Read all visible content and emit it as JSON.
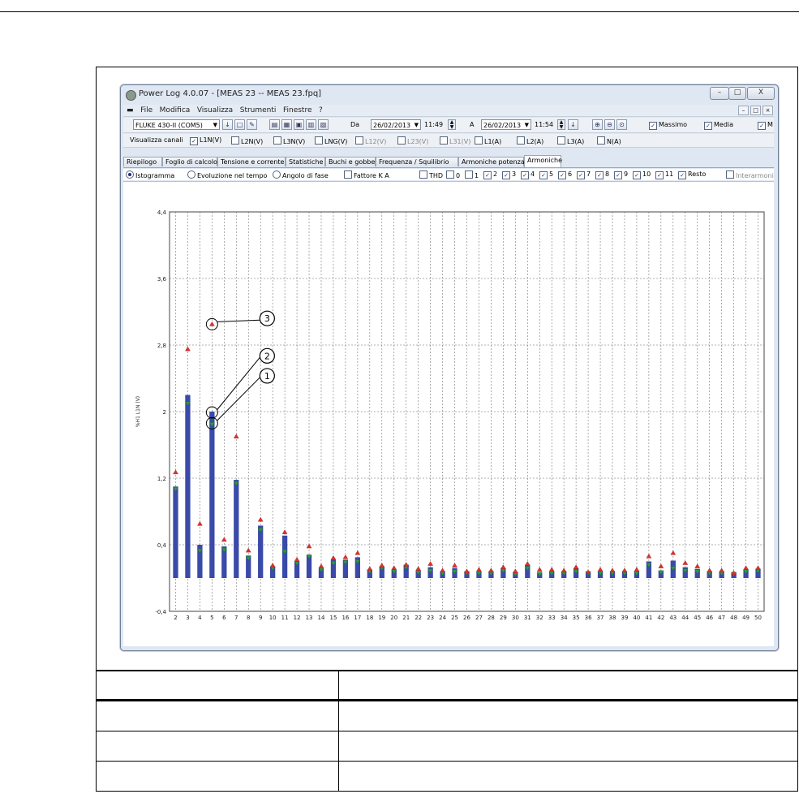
{
  "window": {
    "title": "Power Log 4.0.07 - [MEAS 23 -- MEAS 23.fpq]",
    "controls": {
      "minimize": "–",
      "maximize": "□",
      "close": "X"
    }
  },
  "menu": [
    "File",
    "Modifica",
    "Visualizza",
    "Strumenti",
    "Finestre",
    "?"
  ],
  "mdi_controls": [
    "–",
    "□",
    "×"
  ],
  "toolbar": {
    "device": "FLUKE 430-II (COM5)",
    "from_label": "Da",
    "from_date": "26/02/2013",
    "from_time": "11:49",
    "to_label": "A",
    "to_date": "26/02/2013",
    "to_time": "11:54",
    "checks": [
      {
        "label": "Massimo",
        "checked": true
      },
      {
        "label": "Media",
        "checked": true
      },
      {
        "label": "M",
        "checked": true
      }
    ]
  },
  "channels": {
    "label": "Visualizza canali",
    "items": [
      {
        "label": "L1N(V)",
        "checked": true,
        "enabled": true
      },
      {
        "label": "L2N(V)",
        "checked": false,
        "enabled": true
      },
      {
        "label": "L3N(V)",
        "checked": false,
        "enabled": true
      },
      {
        "label": "LNG(V)",
        "checked": false,
        "enabled": true
      },
      {
        "label": "L12(V)",
        "checked": false,
        "enabled": false
      },
      {
        "label": "L23(V)",
        "checked": false,
        "enabled": false
      },
      {
        "label": "L31(V)",
        "checked": false,
        "enabled": false
      },
      {
        "label": "L1(A)",
        "checked": false,
        "enabled": true
      },
      {
        "label": "L2(A)",
        "checked": false,
        "enabled": true
      },
      {
        "label": "L3(A)",
        "checked": false,
        "enabled": true
      },
      {
        "label": "N(A)",
        "checked": false,
        "enabled": true
      }
    ]
  },
  "tabs": [
    "Riepilogo",
    "Foglio di calcolo",
    "Tensione e corrente",
    "Statistiche",
    "Buchi e gobbe",
    "Frequenza / Squilibrio",
    "Armoniche potenza",
    "Armoniche"
  ],
  "active_tab": "Armoniche",
  "options": {
    "radios": [
      {
        "label": "Istogramma",
        "selected": true
      },
      {
        "label": "Evoluzione nel tempo",
        "selected": false
      },
      {
        "label": "Angolo di fase",
        "selected": false
      }
    ],
    "factor_k": "Fattore K A",
    "harmonics": [
      {
        "label": "THD",
        "checked": false
      },
      {
        "label": "0",
        "checked": false
      },
      {
        "label": "1",
        "checked": false
      },
      {
        "label": "2",
        "checked": true
      },
      {
        "label": "3",
        "checked": true
      },
      {
        "label": "4",
        "checked": true
      },
      {
        "label": "5",
        "checked": true
      },
      {
        "label": "6",
        "checked": true
      },
      {
        "label": "7",
        "checked": true
      },
      {
        "label": "8",
        "checked": true
      },
      {
        "label": "9",
        "checked": true
      },
      {
        "label": "10",
        "checked": true
      },
      {
        "label": "11",
        "checked": true
      },
      {
        "label": "Resto",
        "checked": true
      }
    ],
    "interharmonics": "Interarmoni"
  },
  "callouts": [
    "1",
    "2",
    "3"
  ],
  "colors": {
    "bar": "#3a4aa8",
    "max": "#e03030",
    "avg": "#2d9a3c"
  },
  "chart_data": {
    "type": "bar",
    "ylabel": "%H1 L1N (V)",
    "ylim": [
      -0.4,
      4.4
    ],
    "yticks": [
      "4,4",
      "3,6",
      "2,8",
      "2",
      "1,2",
      "0,4",
      "-0,4"
    ],
    "categories": [
      "2",
      "3",
      "4",
      "5",
      "6",
      "7",
      "8",
      "9",
      "10",
      "11",
      "12",
      "13",
      "14",
      "15",
      "16",
      "17",
      "18",
      "19",
      "20",
      "21",
      "22",
      "23",
      "24",
      "25",
      "26",
      "27",
      "28",
      "29",
      "30",
      "31",
      "32",
      "33",
      "34",
      "35",
      "36",
      "37",
      "38",
      "39",
      "40",
      "41",
      "42",
      "43",
      "44",
      "45",
      "46",
      "47",
      "48",
      "49",
      "50"
    ],
    "series": [
      {
        "values": [
          1.1,
          2.2,
          0.4,
          2.0,
          0.38,
          1.18,
          0.27,
          0.63,
          0.14,
          0.51,
          0.2,
          0.28,
          0.12,
          0.22,
          0.22,
          0.25,
          0.1,
          0.14,
          0.1,
          0.16,
          0.09,
          0.13,
          0.08,
          0.12,
          0.08,
          0.08,
          0.08,
          0.12,
          0.07,
          0.16,
          0.07,
          0.08,
          0.08,
          0.12,
          0.08,
          0.08,
          0.08,
          0.08,
          0.08,
          0.2,
          0.09,
          0.21,
          0.13,
          0.11,
          0.08,
          0.08,
          0.07,
          0.1,
          0.11
        ]
      },
      {
        "values": [
          1.27,
          2.75,
          0.65,
          3.05,
          0.46,
          1.7,
          0.33,
          0.7,
          0.15,
          0.55,
          0.22,
          0.38,
          0.14,
          0.24,
          0.25,
          0.3,
          0.11,
          0.15,
          0.12,
          0.16,
          0.11,
          0.17,
          0.09,
          0.15,
          0.08,
          0.1,
          0.09,
          0.13,
          0.08,
          0.17,
          0.1,
          0.1,
          0.09,
          0.13,
          0.07,
          0.1,
          0.09,
          0.09,
          0.1,
          0.26,
          0.14,
          0.3,
          0.18,
          0.14,
          0.09,
          0.09,
          0.06,
          0.12,
          0.12
        ]
      },
      {
        "values": [
          1.07,
          2.1,
          0.33,
          1.85,
          0.34,
          1.14,
          0.24,
          0.58,
          0.12,
          0.32,
          0.18,
          0.26,
          0.1,
          0.18,
          0.19,
          0.2,
          0.08,
          0.12,
          0.08,
          0.13,
          0.07,
          0.09,
          0.06,
          0.08,
          0.06,
          0.06,
          0.06,
          0.09,
          0.05,
          0.12,
          0.05,
          0.06,
          0.06,
          0.08,
          0.06,
          0.06,
          0.06,
          0.06,
          0.06,
          0.16,
          0.07,
          0.12,
          0.09,
          0.08,
          0.06,
          0.06,
          0.05,
          0.08,
          0.09
        ]
      }
    ],
    "series_styles": [
      "bar",
      "red-triangle-up",
      "green-triangle-down"
    ],
    "grid": true
  }
}
